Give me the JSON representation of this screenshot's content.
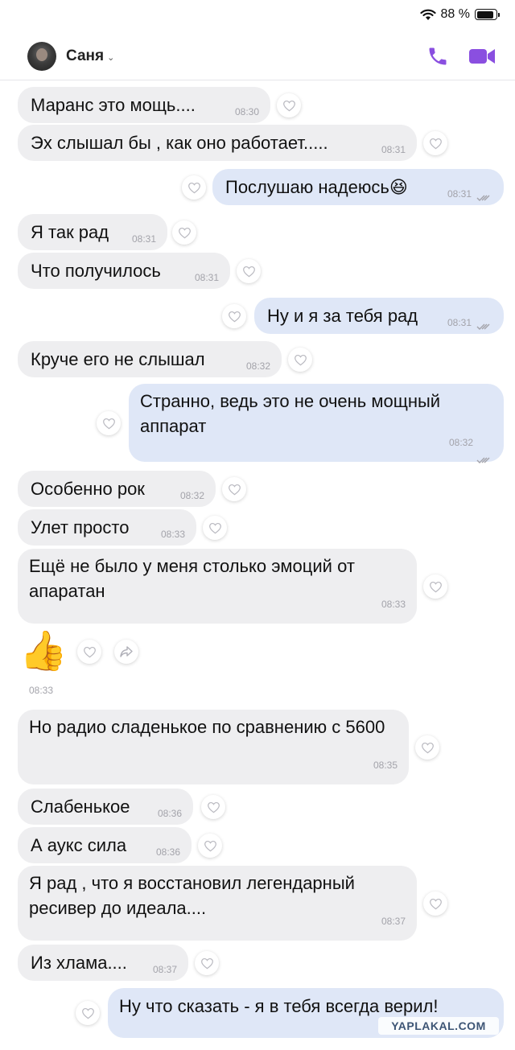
{
  "status": {
    "battery_text": "88 %",
    "battery_level": 0.88
  },
  "header": {
    "contact_name": "Саня",
    "chevron": "⌄",
    "call_icon": "phone-icon",
    "video_icon": "video-camera-icon",
    "accent_color": "#8a4fe0"
  },
  "colors": {
    "incoming_bubble": "#eeeef0",
    "outgoing_bubble": "#dfe7f7",
    "time": "#a3a3aa"
  },
  "messages": [
    {
      "dir": "in",
      "text": "Маранс это мощь....",
      "time": "08:30"
    },
    {
      "dir": "in",
      "text": "Эх слышал бы , как оно работает.....",
      "time": "08:31"
    },
    {
      "dir": "out",
      "text": "Послушаю надеюсь",
      "emoji": "😆",
      "time": "08:31"
    },
    {
      "dir": "in",
      "text": "Я так рад",
      "time": "08:31"
    },
    {
      "dir": "in",
      "text": "Что получилось",
      "time": "08:31"
    },
    {
      "dir": "out",
      "text": "Ну и я за тебя рад",
      "time": "08:31"
    },
    {
      "dir": "in",
      "text": "Круче его не слышал",
      "time": "08:32"
    },
    {
      "dir": "out",
      "text": "Странно, ведь это не очень мощный аппарат",
      "time": "08:32"
    },
    {
      "dir": "in",
      "text": "Особенно рок",
      "time": "08:32"
    },
    {
      "dir": "in",
      "text": "Улет просто",
      "time": "08:33"
    },
    {
      "dir": "in",
      "text": "Ещё не было у меня столько эмоций от апаратан",
      "time": "08:33"
    },
    {
      "dir": "in",
      "sticker": "👍",
      "time": "08:33"
    },
    {
      "dir": "in",
      "text": "Но радио сладенькое по сравнению с 5600",
      "time": "08:35"
    },
    {
      "dir": "in",
      "text": "Слабенькое",
      "time": "08:36"
    },
    {
      "dir": "in",
      "text": "А аукс сила",
      "time": "08:36"
    },
    {
      "dir": "in",
      "text": "Я рад , что я восстановил легендарный ресивер до идеала....",
      "time": "08:37"
    },
    {
      "dir": "in",
      "text": "Из хлама....",
      "time": "08:37"
    },
    {
      "dir": "out",
      "text": "Ну что сказать - я в тебя всегда верил!",
      "time": ""
    }
  ],
  "watermark": "YAPLAKAL.COM"
}
